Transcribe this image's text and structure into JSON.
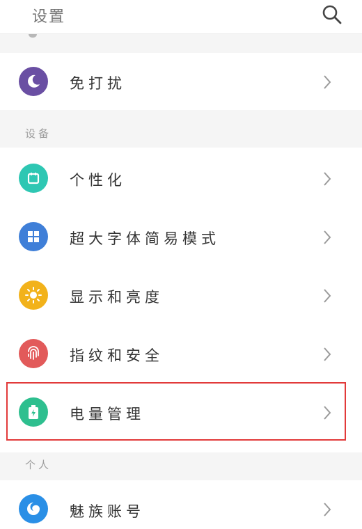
{
  "header": {
    "title": "设置"
  },
  "sections": [
    {
      "label": "设备"
    },
    {
      "label": "个人"
    }
  ],
  "rows": [
    {
      "label": "免打扰",
      "icon": "moon-icon",
      "color": "#6a4fa3"
    },
    {
      "label": "个性化",
      "icon": "personalize-icon",
      "color": "#2ec7b3"
    },
    {
      "label": "超大字体简易模式",
      "icon": "grid-icon",
      "color": "#3f7fd8"
    },
    {
      "label": "显示和亮度",
      "icon": "sun-icon",
      "color": "#f2b21b"
    },
    {
      "label": "指纹和安全",
      "icon": "fingerprint-icon",
      "color": "#e25a5a"
    },
    {
      "label": "电量管理",
      "icon": "battery-icon",
      "color": "#2ebf8f",
      "highlighted": true
    },
    {
      "label": "魅族账号",
      "icon": "account-icon",
      "color": "#2a8fe6"
    }
  ],
  "colors": {
    "highlight": "#e23a3a",
    "text": "#333333",
    "section": "#9d9d9d"
  }
}
